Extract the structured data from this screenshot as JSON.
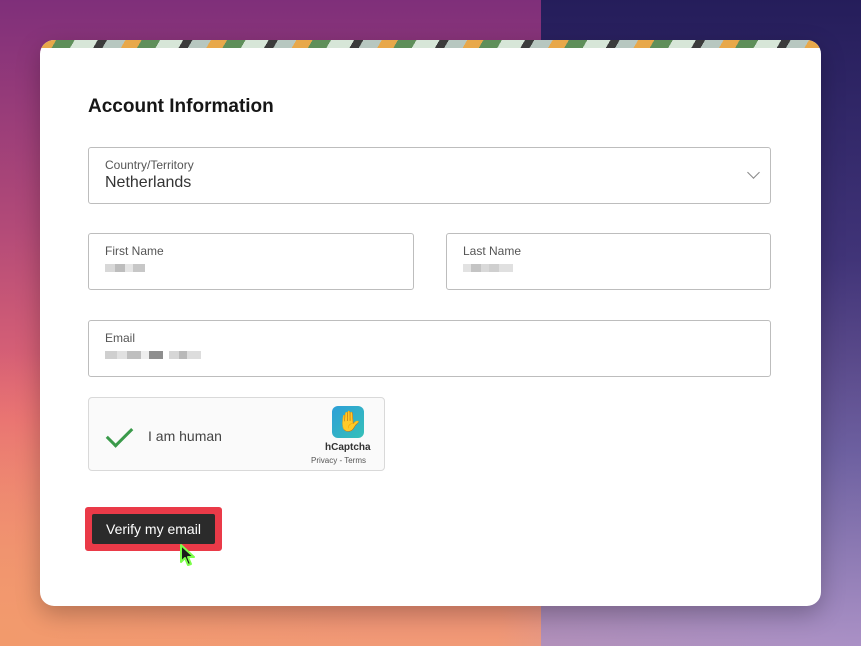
{
  "form": {
    "title": "Account Information",
    "country": {
      "label": "Country/Territory",
      "value": "Netherlands"
    },
    "first_name": {
      "label": "First Name"
    },
    "last_name": {
      "label": "Last Name"
    },
    "email": {
      "label": "Email"
    }
  },
  "captcha": {
    "label": "I am human",
    "brand": "hCaptcha",
    "privacy": "Privacy",
    "separator": " - ",
    "terms": "Terms",
    "checked": true
  },
  "actions": {
    "verify_label": "Verify my email"
  },
  "colors": {
    "highlight": "#ea3a48",
    "button": "#2b2b2b",
    "check": "#3a9a4a"
  }
}
